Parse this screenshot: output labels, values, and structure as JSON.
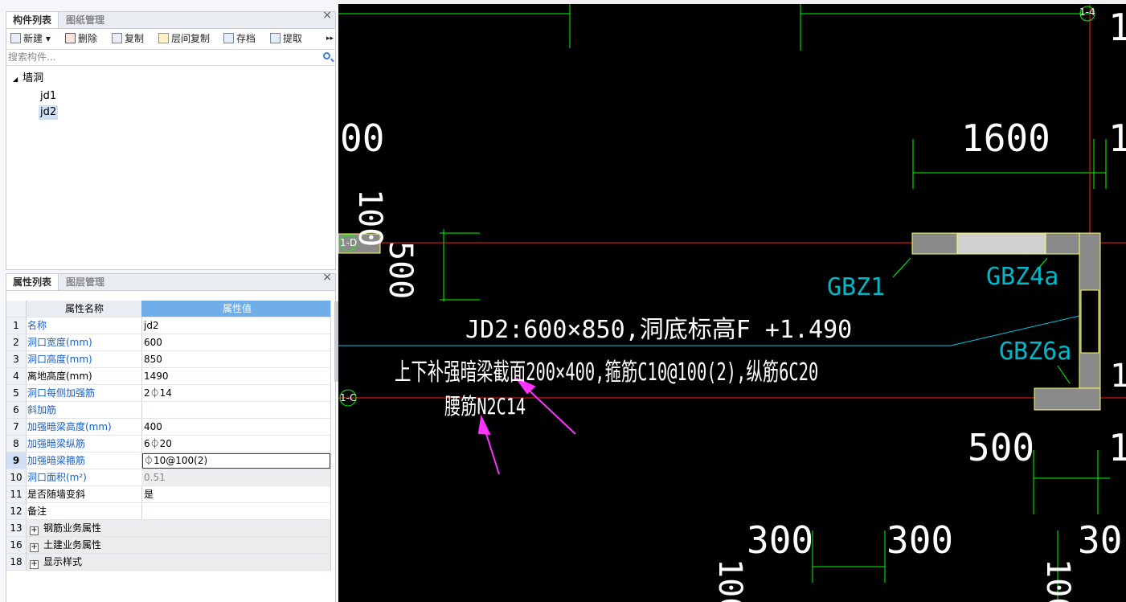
{
  "components_panel": {
    "tabs": [
      "构件列表",
      "图纸管理"
    ],
    "close": "×",
    "toolbar": [
      "新建",
      "删除",
      "复制",
      "层间复制",
      "存档",
      "提取"
    ],
    "toolbar_more": "▸▸",
    "search_placeholder": "搜索构件...",
    "tree": {
      "root": "墙洞",
      "items": [
        "jd1",
        "jd2"
      ],
      "selected": "jd2"
    }
  },
  "properties_panel": {
    "tabs": [
      "属性列表",
      "图层管理"
    ],
    "close": "×",
    "headers": {
      "name": "属性名称",
      "value": "属性值"
    },
    "rows": [
      {
        "no": "1",
        "name": "名称",
        "value": "jd2"
      },
      {
        "no": "2",
        "name": "洞口宽度(mm)",
        "value": "600"
      },
      {
        "no": "3",
        "name": "洞口高度(mm)",
        "value": "850"
      },
      {
        "no": "4",
        "name": "离地高度(mm)",
        "value": "1490"
      },
      {
        "no": "5",
        "name": "洞口每侧加强筋",
        "value": "2⏀14"
      },
      {
        "no": "6",
        "name": "斜加筋",
        "value": ""
      },
      {
        "no": "7",
        "name": "加强暗梁高度(mm)",
        "value": "400"
      },
      {
        "no": "8",
        "name": "加强暗梁纵筋",
        "value": "6⏀20"
      },
      {
        "no": "9",
        "name": "加强暗梁箍筋",
        "value": "⏀10@100(2)"
      },
      {
        "no": "10",
        "name": "洞口面积(m²)",
        "value": "0.51"
      },
      {
        "no": "11",
        "name": "是否随墙变斜",
        "value": "是"
      },
      {
        "no": "12",
        "name": "备注",
        "value": ""
      },
      {
        "no": "13",
        "name": "钢筋业务属性",
        "value": ""
      },
      {
        "no": "16",
        "name": "土建业务属性",
        "value": ""
      },
      {
        "no": "18",
        "name": "显示样式",
        "value": ""
      }
    ]
  },
  "drawing": {
    "dims": [
      "1600",
      "00",
      "100",
      "500",
      "500",
      "300",
      "300",
      "30",
      "1",
      "1",
      "1",
      "1",
      "100",
      "100"
    ],
    "axis_labels": [
      "1-D",
      "1-C",
      "1-4"
    ],
    "wall_labels": [
      "GBZ1",
      "GBZ4a",
      "GBZ6a"
    ],
    "opening_note": "JD2:600×850,洞底标高F +1.490",
    "beam_note": "上下补强暗梁截面200×400,箍筋C10@100(2),纵筋6C20",
    "waist_note": "腰筋N2C14",
    "colors": {
      "background": "#000000",
      "dim": "#00ff00",
      "axis": "#ff0000",
      "text": "#ffffff",
      "label": "#00b8c8",
      "arrow": "#ff33ff",
      "wall": "#8a8a8a"
    }
  }
}
